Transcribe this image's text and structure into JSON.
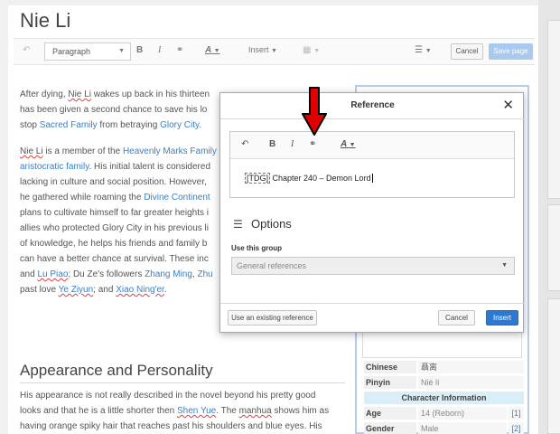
{
  "page": {
    "title": "Nie Li"
  },
  "toolbar": {
    "undo_icon": "undo-icon",
    "paragraph_label": "Paragraph",
    "bold_label": "B",
    "italic_label": "I",
    "link_icon": "link-icon",
    "text_style_label": "A",
    "insert_label": "Insert",
    "table_icon": "table-icon",
    "menu_icon": "hamburger-icon",
    "cancel_label": "Cancel",
    "save_label": "Save page"
  },
  "article": {
    "p1": {
      "a": "After dying, ",
      "b": "Nie Li",
      "c": " wakes up back in his thirteen",
      "d": " has been given a second chance to save his lo",
      "e": "stop ",
      "f": "Sacred Family",
      "g": " from betraying ",
      "h": "Glory City",
      "i": "."
    },
    "p2": {
      "l1a": "Nie Li",
      "l1b": " is a member of the ",
      "l1c": "Heavenly Marks Family",
      "l2a": "aristocratic family",
      "l2b": ". His initial talent is considered",
      "l3": "lacking in culture and social position. However,",
      "l4a": "he gathered while roaming the ",
      "l4b": "Divine Continent",
      "l5": "plans to cultivate himself to far greater heights i",
      "l6": "allies who protected Glory City in his previous li",
      "l7": "of knowledge, he helps his friends and family b",
      "l8": "can have a better chance at survival. These inc",
      "l9a": "and ",
      "l9b": "Lu Piao",
      "l9c": "; Du Ze's followers ",
      "l9d": "Zhang Ming",
      "l9e": ", ",
      "l9f": "Zhu",
      "l10a": "past love ",
      "l10b": "Ye Ziyun",
      "l10c": "; and ",
      "l10d": "Xiao Ning'er",
      "l10e": "."
    },
    "section_heading": "Appearance and Personality",
    "p3": {
      "l1": "His appearance is not really described in the novel beyond his pretty good",
      "l2a": "looks and that he is a little shorter then ",
      "l2b": "Shen Yue",
      "l2c": ". The ",
      "l2d": "manhua",
      "l2e": " shows him as",
      "l3": "having orange spiky hair that reaches past his shoulders and blue eyes. His"
    }
  },
  "infobox": {
    "chinese_key": "Chinese",
    "chinese_val": "聶离",
    "pinyin_key": "Pinyin",
    "pinyin_val": "Niè lí",
    "char_info_header": "Character Information",
    "age_key": "Age",
    "age_val": "14 (Reborn)",
    "age_ref": "[1]",
    "gender_key": "Gender",
    "gender_val": "Male",
    "gender_ref": "[2]"
  },
  "dialog": {
    "title": "Reference",
    "close_icon": "close-icon",
    "editor": {
      "undo_icon": "undo-icon",
      "bold_label": "B",
      "italic_label": "I",
      "link_icon": "link-icon",
      "text_style_label": "A",
      "content_tag": "[TDG]",
      "content_text": " Chapter 240 – Demon Lord"
    },
    "options_label": "Options",
    "options_icon": "sliders-icon",
    "group_label": "Use this group",
    "group_value": "General references",
    "existing_ref_label": "Use an existing reference",
    "cancel_label": "Cancel",
    "insert_label": "Insert"
  },
  "annotation": {
    "arrow_color": "#e00000",
    "arrow_icon": "red-arrow-down-icon"
  }
}
